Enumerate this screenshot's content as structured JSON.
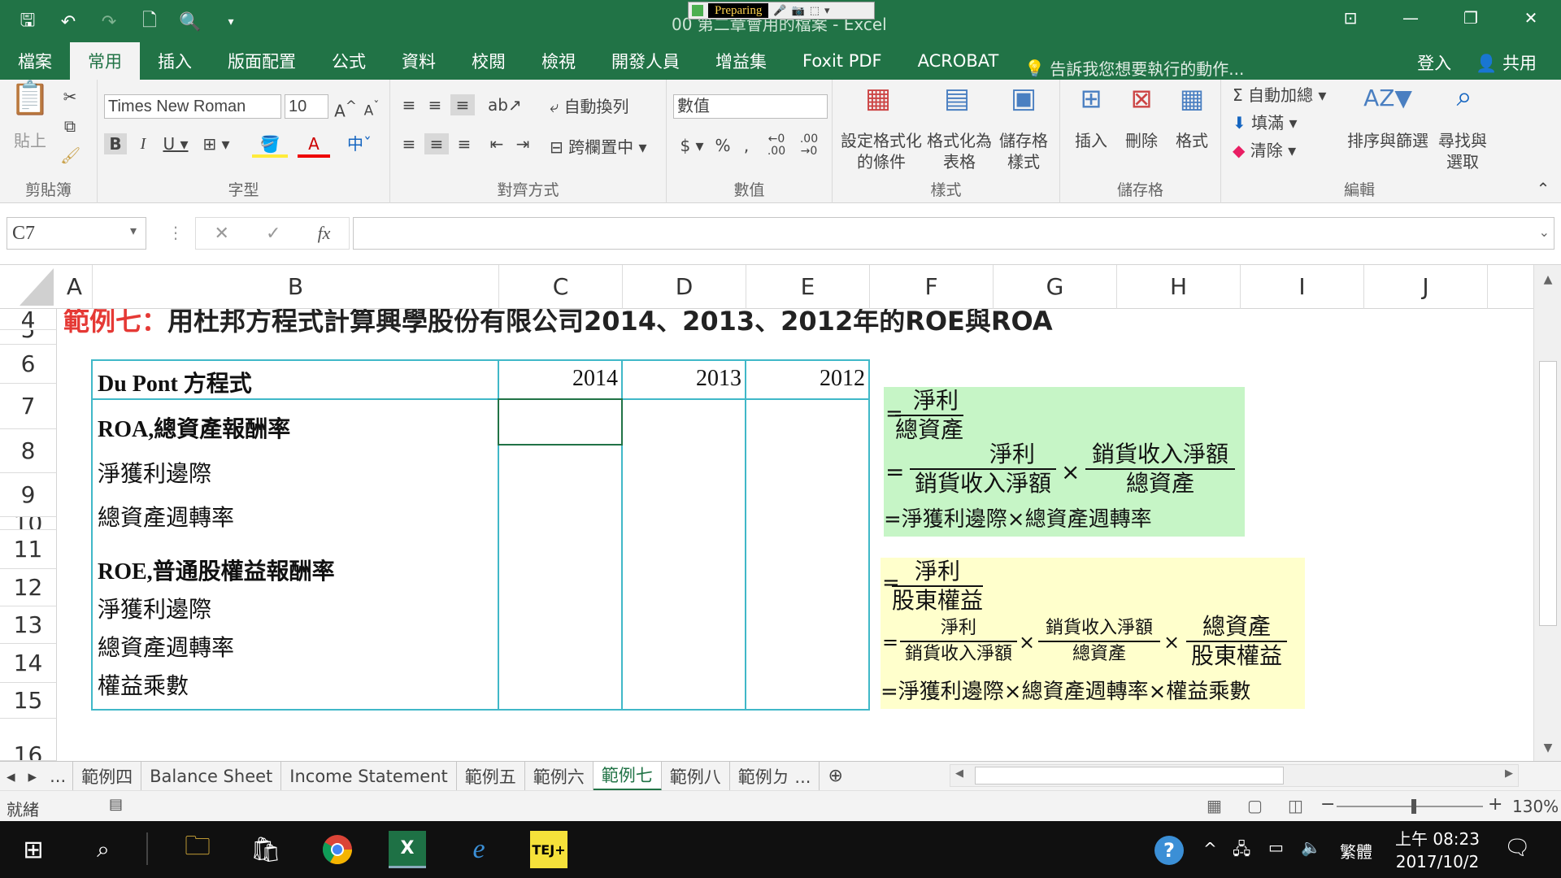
{
  "window": {
    "title": "00 第二章會用的檔案 - Excel",
    "preparing_label": "Preparing",
    "controls": [
      "⊡",
      "—",
      "❐",
      "✕"
    ]
  },
  "ribbon_tabs": [
    "檔案",
    "常用",
    "插入",
    "版面配置",
    "公式",
    "資料",
    "校閱",
    "檢視",
    "開發人員",
    "增益集",
    "Foxit PDF",
    "ACROBAT"
  ],
  "active_tab": "常用",
  "tell_me": "告訴我您想要執行的動作...",
  "sign_in": "登入",
  "share": "共用",
  "ribbon": {
    "clipboard": {
      "paste": "貼上",
      "label": "剪貼簿"
    },
    "font": {
      "name": "Times New Roman",
      "size": "10",
      "label": "字型"
    },
    "alignment": {
      "wrap": "自動換列",
      "merge": "跨欄置中",
      "label": "對齊方式"
    },
    "number": {
      "format": "數值",
      "label": "數值"
    },
    "styles": {
      "conditional": "設定格式化\n的條件",
      "table": "格式化為\n表格",
      "cell_styles": "儲存格\n樣式",
      "label": "樣式"
    },
    "cells": {
      "insert": "插入",
      "delete": "刪除",
      "format": "格式",
      "label": "儲存格"
    },
    "editing": {
      "autosum": "自動加總",
      "fill": "填滿",
      "clear": "清除",
      "sort": "排序與篩選",
      "find": "尋找與\n選取",
      "label": "編輯"
    }
  },
  "name_box": "C7",
  "formula_value": "",
  "columns": [
    "A",
    "B",
    "C",
    "D",
    "E",
    "F",
    "G",
    "H",
    "I",
    "J"
  ],
  "rows": [
    "4",
    "5",
    "6",
    "7",
    "8",
    "9",
    "10",
    "11",
    "12",
    "13",
    "14",
    "15",
    "16"
  ],
  "sheet": {
    "heading_prefix": "範例七：",
    "heading_text": "用杜邦方程式計算興學股份有限公司2014、2013、2012年的ROE與ROA",
    "table_header": {
      "label": "Du Pont 方程式",
      "years": [
        "2014",
        "2013",
        "2012"
      ]
    },
    "roa_rows": [
      "ROA,總資產報酬率",
      "淨獲利邊際",
      "總資產週轉率"
    ],
    "roe_rows": [
      "ROE,普通股權益報酬率",
      "淨獲利邊際",
      "總資產週轉率",
      "權益乘數"
    ]
  },
  "roa_box": {
    "f1_num": "淨利",
    "f1_den": "總資產",
    "f2a_num": "淨利",
    "f2a_den": "銷貨收入淨額",
    "f2b_num": "銷貨收入淨額",
    "f2b_den": "總資產",
    "line3": "=淨獲利邊際×總資產週轉率",
    "color": "#c6f5c6"
  },
  "roe_box": {
    "f1_num": "淨利",
    "f1_den": "股東權益",
    "f2a_num": "淨利",
    "f2a_den": "銷貨收入淨額",
    "f2b_num": "銷貨收入淨額",
    "f2b_den": "總資產",
    "f2c_num": "總資產",
    "f2c_den": "股東權益",
    "line3": "=淨獲利邊際×總資產週轉率×權益乘數",
    "color": "#ffffcc"
  },
  "sheet_tabs": [
    "範例四",
    "Balance Sheet",
    "Income Statement",
    "範例五",
    "範例六",
    "範例七",
    "範例八",
    "範例ㄉ ..."
  ],
  "active_sheet": "範例七",
  "status": {
    "ready": "就緒",
    "zoom": "130%"
  },
  "taskbar": {
    "lang": "繁體",
    "time": "上午 08:23",
    "date": "2017/10/2"
  }
}
